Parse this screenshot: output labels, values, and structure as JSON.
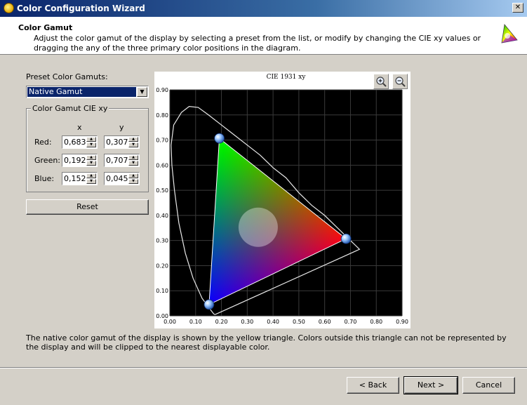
{
  "window": {
    "title": "Color Configuration Wizard",
    "close_label": "✕"
  },
  "header": {
    "title": "Color Gamut",
    "description": "Adjust the color gamut of the display by selecting a preset from the list, or modify by changing the CIE xy values or dragging the any of the three primary color positions in the diagram."
  },
  "preset": {
    "label": "Preset Color Gamuts:",
    "selected": "Native Gamut"
  },
  "gamut_box": {
    "title": "Color Gamut CIE xy",
    "col_x": "x",
    "col_y": "y",
    "rows": [
      {
        "label": "Red:",
        "x": "0,683",
        "y": "0,307"
      },
      {
        "label": "Green:",
        "x": "0,192",
        "y": "0,707"
      },
      {
        "label": "Blue:",
        "x": "0,152",
        "y": "0,045"
      }
    ]
  },
  "reset_label": "Reset",
  "chart_data": {
    "type": "scatter",
    "title": "CIE 1931 xy",
    "xlim": [
      0,
      0.9
    ],
    "ylim": [
      0,
      0.9
    ],
    "x_ticks": [
      "0.00",
      "0.10",
      "0.20",
      "0.30",
      "0.40",
      "0.50",
      "0.60",
      "0.70",
      "0.80",
      "0.90"
    ],
    "y_ticks": [
      "0.00",
      "0.10",
      "0.20",
      "0.30",
      "0.40",
      "0.50",
      "0.60",
      "0.70",
      "0.80",
      "0.90"
    ],
    "grid": true,
    "primaries": [
      {
        "name": "Red",
        "x": 0.683,
        "y": 0.307
      },
      {
        "name": "Green",
        "x": 0.192,
        "y": 0.707
      },
      {
        "name": "Blue",
        "x": 0.152,
        "y": 0.045
      }
    ],
    "locus": [
      [
        0.175,
        0.005
      ],
      [
        0.17,
        0.008
      ],
      [
        0.155,
        0.028
      ],
      [
        0.125,
        0.07
      ],
      [
        0.09,
        0.15
      ],
      [
        0.06,
        0.25
      ],
      [
        0.035,
        0.37
      ],
      [
        0.018,
        0.5
      ],
      [
        0.008,
        0.6
      ],
      [
        0.005,
        0.68
      ],
      [
        0.015,
        0.76
      ],
      [
        0.045,
        0.81
      ],
      [
        0.075,
        0.834
      ],
      [
        0.11,
        0.83
      ],
      [
        0.15,
        0.8
      ],
      [
        0.2,
        0.76
      ],
      [
        0.25,
        0.72
      ],
      [
        0.3,
        0.68
      ],
      [
        0.35,
        0.64
      ],
      [
        0.4,
        0.59
      ],
      [
        0.45,
        0.55
      ],
      [
        0.5,
        0.49
      ],
      [
        0.55,
        0.44
      ],
      [
        0.6,
        0.4
      ],
      [
        0.65,
        0.35
      ],
      [
        0.7,
        0.3
      ],
      [
        0.735,
        0.265
      ],
      [
        0.175,
        0.005
      ]
    ]
  },
  "footer_text": "The native color gamut of the display is shown by the yellow triangle. Colors outside this triangle can not be represented by the display and will be clipped to the nearest displayable color.",
  "buttons": {
    "back": "< Back",
    "next": "Next >",
    "cancel": "Cancel"
  },
  "icons": {
    "zoom_in": "zoom-in-icon",
    "zoom_out": "zoom-out-icon",
    "dropdown": "chevron-down-icon"
  }
}
